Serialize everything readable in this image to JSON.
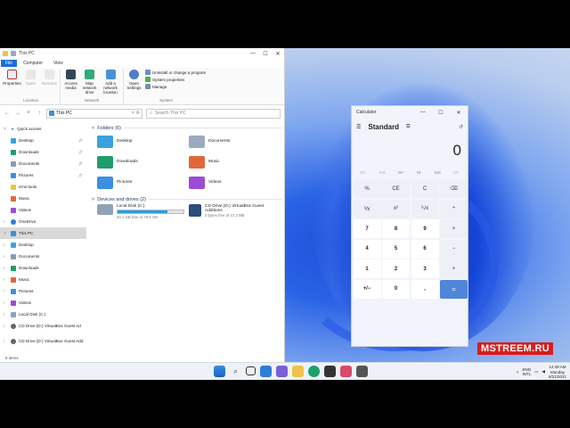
{
  "explorer": {
    "title": "This PC",
    "tabs": [
      "File",
      "Computer",
      "View"
    ],
    "ribbon": {
      "location": {
        "name": "Location",
        "items": [
          "Properties",
          "Open",
          "Rename"
        ]
      },
      "network": {
        "name": "Network",
        "items": [
          "Access media",
          "Map network drive",
          "Add a network location"
        ]
      },
      "system": {
        "name": "System",
        "open_settings": "Open Settings",
        "small": [
          "Uninstall or change a program",
          "System properties",
          "Manage"
        ]
      }
    },
    "address": "This PC",
    "search_placeholder": "Search This PC",
    "nav": {
      "quick_access": "Quick access",
      "quick_items": [
        "Desktop",
        "Downloads",
        "Documents",
        "Pictures",
        "erns-tools",
        "Music",
        "Videos"
      ],
      "onedrive": "OneDrive",
      "this_pc": "This PC",
      "pc_items": [
        "Desktop",
        "Documents",
        "Downloads",
        "Music",
        "Pictures",
        "Videos",
        "Local Disk (C:)",
        "CD Drive (D:) VirtualBox Guest Ad"
      ],
      "last": "CD Drive (D:) VirtualBox Guest Add"
    },
    "folders_header": "Folders (6)",
    "folders": [
      "Desktop",
      "Documents",
      "Downloads",
      "Music",
      "Pictures",
      "Videos"
    ],
    "devices_header": "Devices and drives (2)",
    "drives": [
      {
        "name": "Local Disk (C:)",
        "info": "20,1 GB free of 79,9 GB",
        "used": 0.75
      },
      {
        "name": "CD Drive (D:) VirtualBox Guest Additions",
        "info": "0 bytes free of 47,3 MB"
      }
    ],
    "status": "8 items"
  },
  "calculator": {
    "title": "Calculator",
    "mode": "Standard",
    "display": "0",
    "memory": [
      "MC",
      "MR",
      "M+",
      "M-",
      "MS",
      "M˅"
    ],
    "keys": [
      "%",
      "CE",
      "C",
      "⌫",
      "⅟x",
      "x²",
      "²√x",
      "÷",
      "7",
      "8",
      "9",
      "×",
      "4",
      "5",
      "6",
      "−",
      "1",
      "2",
      "3",
      "+",
      "+/−",
      "0",
      ",",
      "="
    ]
  },
  "taskbar": {
    "lang": [
      "ENG",
      "INTL"
    ],
    "time": "12:48 AM",
    "day": "Monday",
    "date": "6/21/2021"
  },
  "watermark": "MSTREEM.RU"
}
